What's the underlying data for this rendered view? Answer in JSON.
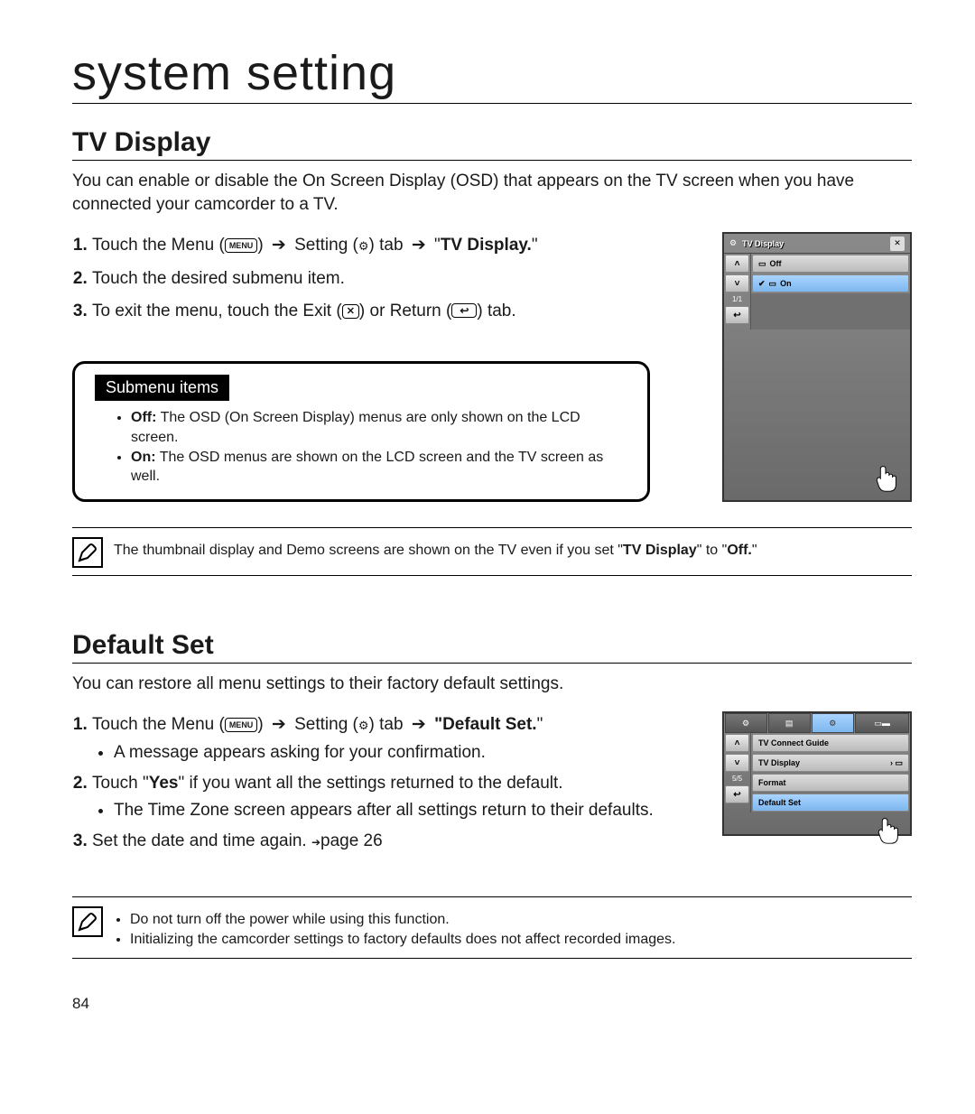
{
  "page_title": "system setting",
  "page_number": "84",
  "sections": {
    "tv_display": {
      "title": "TV Display",
      "intro": "You can enable or disable the On Screen Display (OSD) that appears on the TV screen when you have connected your camcorder to a TV.",
      "step1_pre": "Touch the Menu (",
      "step1_post": ") ",
      "step1_set_pre": " Setting (",
      "step1_set_post": ") tab ",
      "step1_quote": " \"",
      "step1_bold": "TV Display.",
      "step1_end": "\"",
      "step2": "Touch the desired submenu item.",
      "step3_pre": "To exit the menu, touch the Exit (",
      "step3_mid": ") or Return (",
      "step3_post": ") tab.",
      "menu_label": "MENU",
      "submenu_title": "Submenu items",
      "submenu_off_label": "Off:",
      "submenu_off_text": " The OSD (On Screen Display) menus are only shown on the LCD screen.",
      "submenu_on_label": "On:",
      "submenu_on_text": " The OSD menus are shown on the LCD screen and the TV screen as well.",
      "note_pre": "The thumbnail display and Demo screens are shown on the TV even if you set \"",
      "note_b1": "TV Display",
      "note_mid": "\" to \"",
      "note_b2": "Off.",
      "note_post": "\""
    },
    "default_set": {
      "title": "Default Set",
      "intro": "You can restore all menu settings to their factory default settings.",
      "step1_pre": "Touch the Menu (",
      "step1_post": ") ",
      "step1_set_pre": " Setting (",
      "step1_set_post": ") tab ",
      "step1_bold": "\"Default Set.",
      "step1_end": "\"",
      "step1_bullet": "A message appears asking for your confirmation.",
      "step2_pre": "Touch \"",
      "step2_yes": "Yes",
      "step2_post": "\" if you want all the settings returned to the default.",
      "step2_bullet": "The Time Zone screen appears after all settings return to their defaults.",
      "step3": "Set the date and time again. ",
      "step3_ref": "page 26",
      "menu_label": "MENU",
      "notes": [
        "Do not turn off the power while using this function.",
        "Initializing the camcorder settings to factory defaults does not affect recorded images."
      ]
    }
  },
  "screenshots": {
    "tv": {
      "header": "TV Display",
      "item_off": "Off",
      "item_on": "On",
      "page_indicator": "1/1"
    },
    "ds": {
      "items": [
        "TV Connect Guide",
        "TV Display",
        "Format",
        "Default Set"
      ],
      "page_indicator": "5/5"
    }
  }
}
